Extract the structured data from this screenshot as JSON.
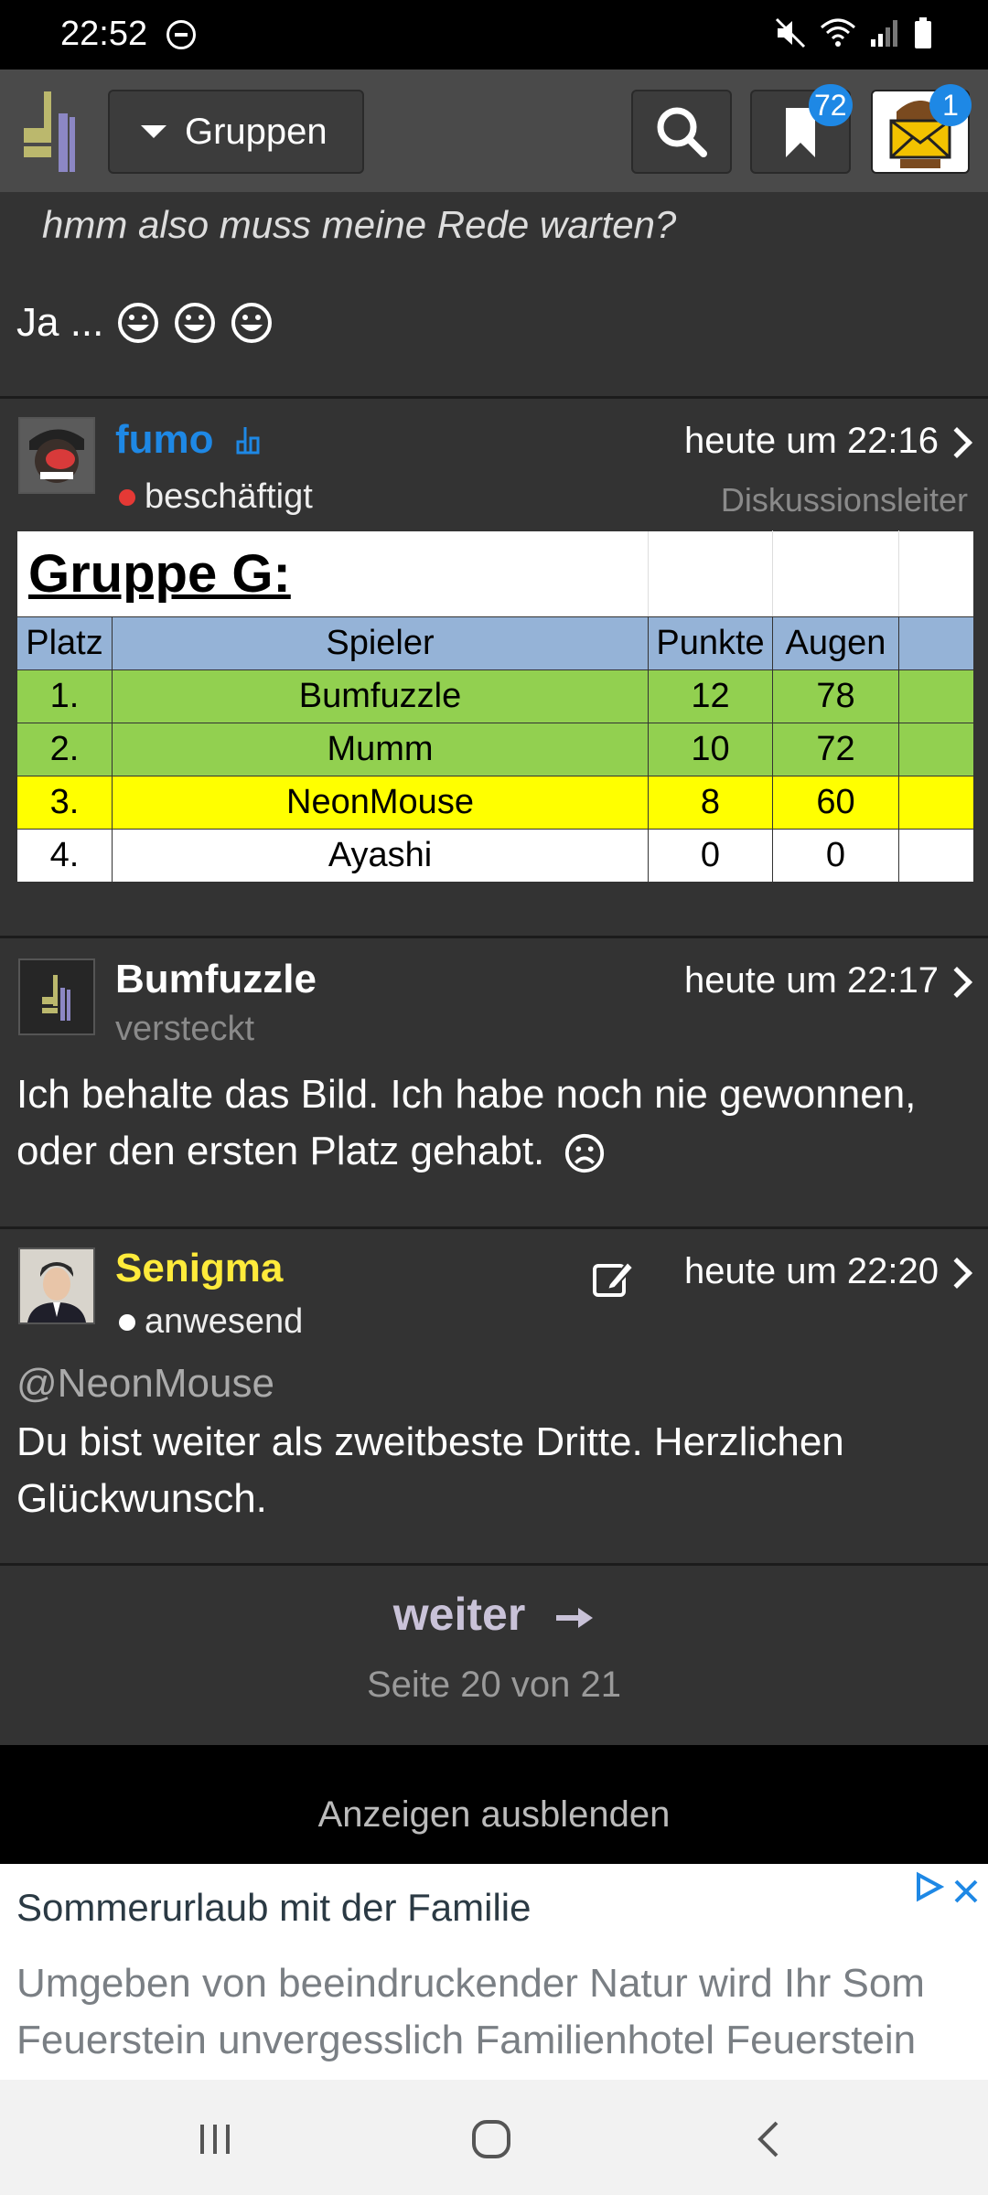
{
  "status_bar": {
    "time": "22:52",
    "icons": [
      "dnd-icon",
      "mute-icon",
      "wifi-icon",
      "signal-icon",
      "battery-icon"
    ]
  },
  "header": {
    "groups_label": "Gruppen",
    "bookmark_badge": "72",
    "messages_badge": "1"
  },
  "previous_post": {
    "quote": "hmm also muss meine Rede warten?",
    "answer": "Ja ..."
  },
  "posts": [
    {
      "username": "fumo",
      "user_color": "#1e88e5",
      "status": "beschäftigt",
      "status_color": "#e53935",
      "time": "heute um 22:16",
      "role": "Diskussionsleiter",
      "table": {
        "title": "Gruppe G:",
        "headers": [
          "Platz",
          "Spieler",
          "Punkte",
          "Augen"
        ],
        "rows": [
          [
            "1.",
            "Bumfuzzle",
            "12",
            "78"
          ],
          [
            "2.",
            "Mumm",
            "10",
            "72"
          ],
          [
            "3.",
            "NeonMouse",
            "8",
            "60"
          ],
          [
            "4.",
            "Ayashi",
            "0",
            "0"
          ]
        ]
      }
    },
    {
      "username": "Bumfuzzle",
      "user_color": "#ffffff",
      "status": "versteckt",
      "time": "heute um 22:17",
      "body": "Ich behalte das Bild. Ich habe noch nie gewonnen, oder den ersten Platz gehabt."
    },
    {
      "username": "Senigma",
      "user_color": "#ffeb3b",
      "status": "anwesend",
      "status_color": "#ffffff",
      "time": "heute um 22:20",
      "mention": "@NeonMouse",
      "body": "Du bist weiter als zweitbeste Dritte. Herzlichen Glückwunsch."
    }
  ],
  "pagination": {
    "next_label": "weiter",
    "page_info": "Seite 20 von 21"
  },
  "ads": {
    "hide_label": "Anzeigen ausblenden",
    "title": "Sommerurlaub mit der Familie",
    "text_line1": "Umgeben von beeindruckender Natur wird Ihr Som",
    "text_line2": "Feuerstein unvergesslich Familienhotel Feuerstein"
  }
}
